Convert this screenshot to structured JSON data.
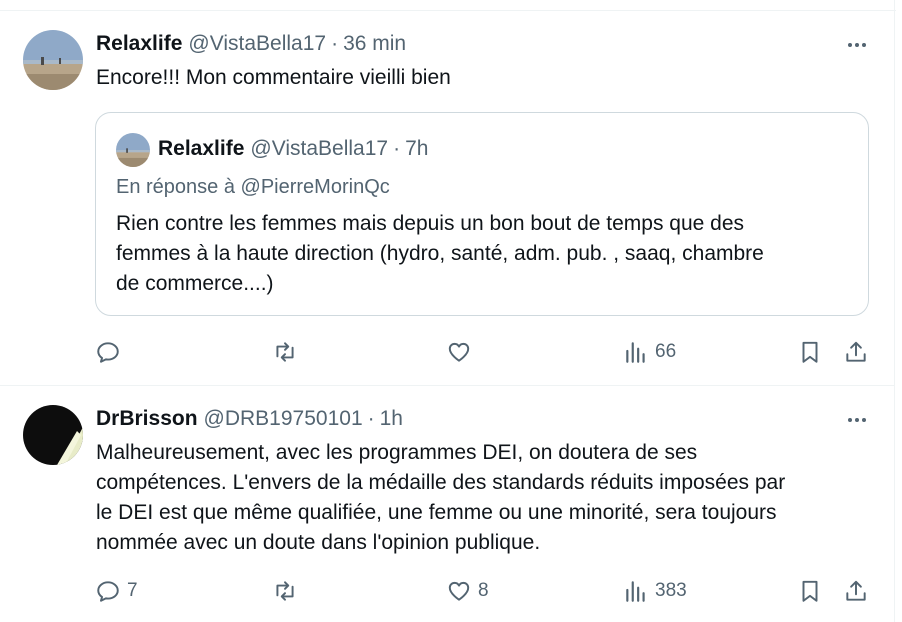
{
  "colors": {
    "text_primary": "#0f1419",
    "text_secondary": "#536471",
    "border": "#cfd9de",
    "divider": "#eff3f4"
  },
  "posts": [
    {
      "author_name": "Relaxlife",
      "handle": "@VistaBella17",
      "separator": "·",
      "time": "36 min",
      "text": "Encore!!! Mon commentaire vieilli bien",
      "quoted": {
        "author_name": "Relaxlife",
        "handle": "@VistaBella17",
        "separator": "·",
        "time": "7h",
        "reply_to": "En réponse à @PierreMorinQc",
        "text_lines": [
          "Rien contre les femmes mais depuis un bon bout de temps que des",
          "femmes à la haute direction (hydro, santé, adm. pub. , saaq, chambre",
          "de commerce....)"
        ]
      },
      "actions": {
        "reply_count": "",
        "repost_count": "",
        "like_count": "",
        "views_count": "66"
      }
    },
    {
      "author_name": "DrBrisson",
      "handle": "@DRB19750101",
      "separator": "·",
      "time": "1h",
      "text_lines": [
        "Malheureusement,  avec les programmes DEI, on doutera de ses",
        "compétences. L'envers de la médaille des standards réduits imposées par",
        "le DEI est que même qualifiée, une femme ou une minorité, sera toujours",
        "nommée avec un doute dans l'opinion publique."
      ],
      "actions": {
        "reply_count": "7",
        "repost_count": "",
        "like_count": "8",
        "views_count": "383"
      }
    }
  ],
  "icons": [
    "more-icon",
    "reply-icon",
    "repost-icon",
    "like-icon",
    "views-icon",
    "bookmark-icon",
    "share-icon"
  ]
}
